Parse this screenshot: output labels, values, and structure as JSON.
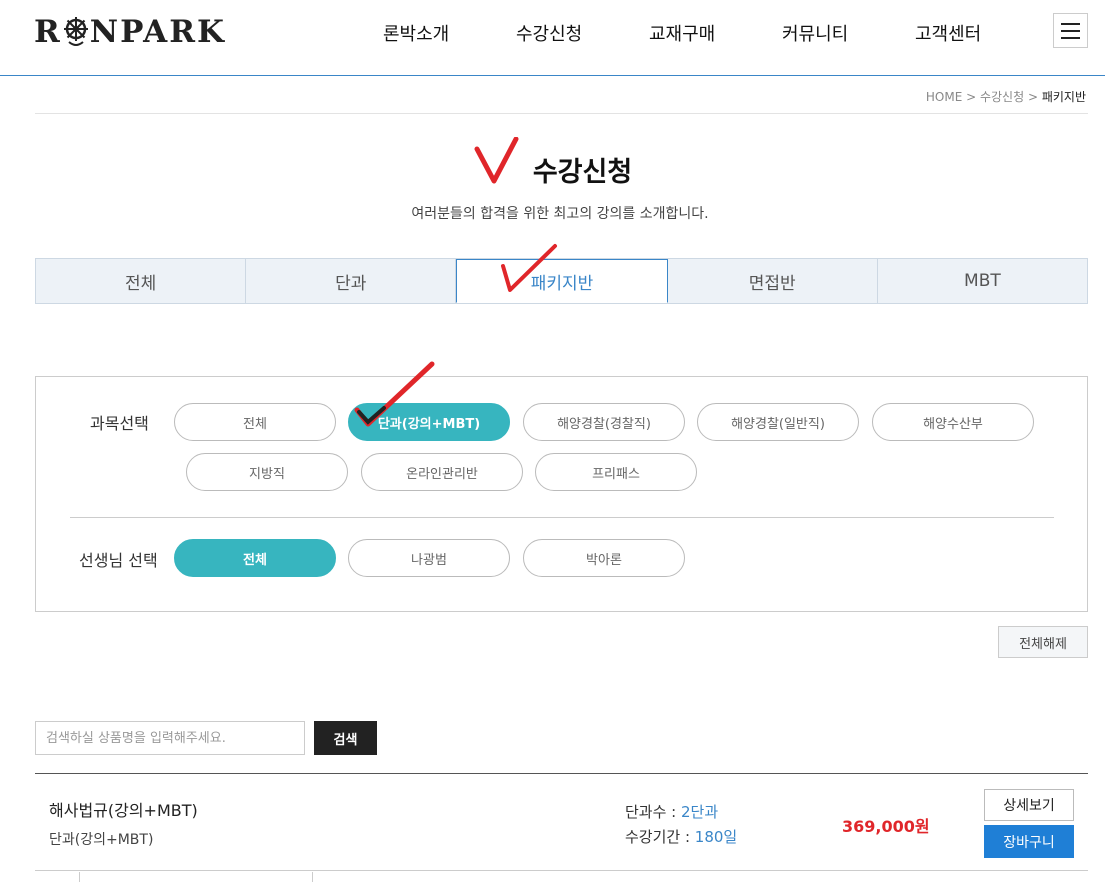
{
  "header": {
    "logo_left": "R",
    "logo_right": "NPARK",
    "nav": [
      "론박소개",
      "수강신청",
      "교재구매",
      "커뮤니티",
      "고객센터"
    ]
  },
  "breadcrumb": {
    "home": "HOME",
    "sep": " > ",
    "level1": "수강신청",
    "current": "패키지반"
  },
  "title": "수강신청",
  "subtitle": "여러분들의 합격을 위한 최고의 강의를 소개합니다.",
  "tabs": [
    {
      "label": "전체",
      "active": false
    },
    {
      "label": "단과",
      "active": false
    },
    {
      "label": "패키지반",
      "active": true
    },
    {
      "label": "면접반",
      "active": false
    },
    {
      "label": "MBT",
      "active": false
    }
  ],
  "filter": {
    "subject_label": "과목선택",
    "subjects": [
      "전체",
      "단과(강의+MBT)",
      "해양경찰(경찰직)",
      "해양경찰(일반직)",
      "해양수산부",
      "지방직",
      "온라인관리반",
      "프리패스"
    ],
    "subject_selected": "단과(강의+MBT)",
    "teacher_label": "선생님 선택",
    "teachers": [
      "전체",
      "나광범",
      "박아론"
    ],
    "teacher_selected": "전체"
  },
  "reset_label": "전체해제",
  "search": {
    "placeholder": "검색하실 상품명을 입력해주세요.",
    "button": "검색"
  },
  "product": {
    "name": "해사법규(강의+MBT)",
    "category": "단과(강의+MBT)",
    "count_label": "단과수 : ",
    "count_value": "2단과",
    "period_label": "수강기간 : ",
    "period_value": "180일",
    "price": "369,000원",
    "detail_button": "상세보기",
    "cart_button": "장바구니"
  },
  "colors": {
    "accent": "#3a86c8",
    "pill_active": "#37b5bf",
    "price": "#e0262a",
    "cart": "#1f7fd6",
    "check_mark": "#e0262a"
  }
}
